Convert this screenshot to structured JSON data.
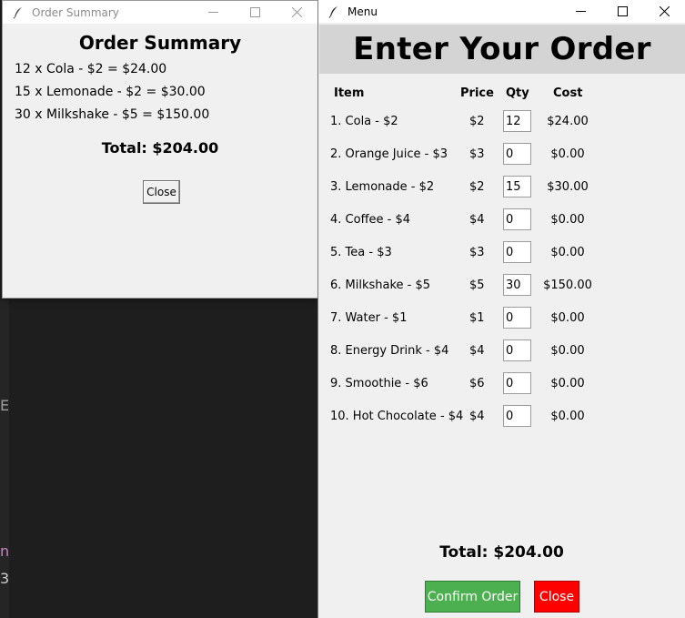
{
  "background": {
    "chars": [
      "E",
      "n",
      "3"
    ]
  },
  "summary_window": {
    "title": "Order Summary",
    "heading": "Order Summary",
    "lines": [
      "12 x Cola - $2 = $24.00",
      "15 x Lemonade - $2 = $30.00",
      "30 x Milkshake - $5 = $150.00"
    ],
    "total": "Total: $204.00",
    "close_label": "Close"
  },
  "menu_window": {
    "title": "Menu",
    "heading": "Enter Your Order",
    "columns": {
      "item": "Item",
      "price": "Price",
      "qty": "Qty",
      "cost": "Cost"
    },
    "rows": [
      {
        "item": "1. Cola - $2",
        "price": "$2",
        "qty": "12",
        "cost": "$24.00"
      },
      {
        "item": "2. Orange Juice - $3",
        "price": "$3",
        "qty": "0",
        "cost": "$0.00"
      },
      {
        "item": "3. Lemonade - $2",
        "price": "$2",
        "qty": "15",
        "cost": "$30.00"
      },
      {
        "item": "4. Coffee - $4",
        "price": "$4",
        "qty": "0",
        "cost": "$0.00"
      },
      {
        "item": "5. Tea - $3",
        "price": "$3",
        "qty": "0",
        "cost": "$0.00"
      },
      {
        "item": "6. Milkshake - $5",
        "price": "$5",
        "qty": "30",
        "cost": "$150.00"
      },
      {
        "item": "7. Water - $1",
        "price": "$1",
        "qty": "0",
        "cost": "$0.00"
      },
      {
        "item": "8. Energy Drink - $4",
        "price": "$4",
        "qty": "0",
        "cost": "$0.00"
      },
      {
        "item": "9. Smoothie - $6",
        "price": "$6",
        "qty": "0",
        "cost": "$0.00"
      },
      {
        "item": "10. Hot Chocolate - $4",
        "price": "$4",
        "qty": "0",
        "cost": "$0.00"
      }
    ],
    "total": "Total: $204.00",
    "confirm_label": "Confirm Order",
    "close_label": "Close"
  },
  "icons": {
    "app": "feather-icon",
    "minimize": "minimize-icon",
    "maximize": "maximize-icon",
    "close": "close-icon"
  },
  "colors": {
    "confirm": "#4caf50",
    "close": "#ff0000",
    "header_bg": "#d4d4d4",
    "window_bg": "#f0f0f0"
  }
}
